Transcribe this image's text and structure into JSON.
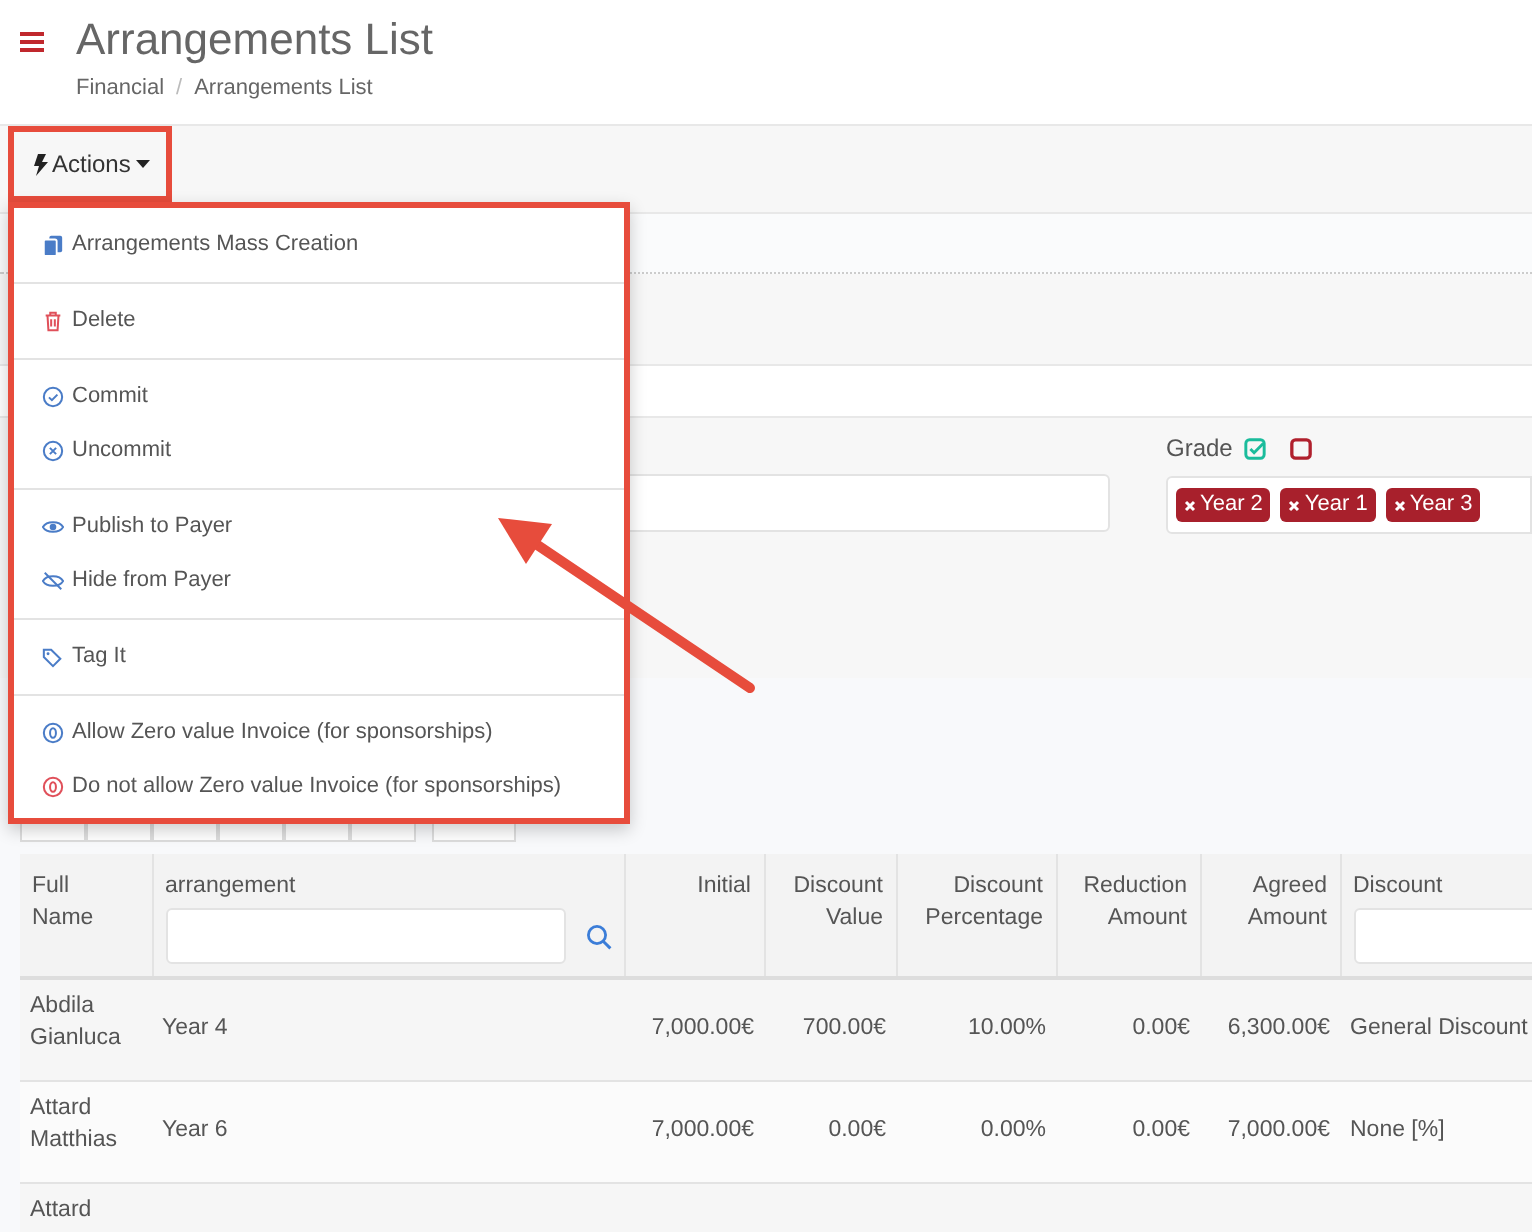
{
  "page": {
    "title": "Arrangements List",
    "breadcrumb_separator": "/",
    "breadcrumb": [
      {
        "label": "Financial"
      },
      {
        "label": "Arrangements List"
      }
    ]
  },
  "actions_button": {
    "label": "Actions"
  },
  "actions_menu": {
    "groups": [
      [
        {
          "label": "Arrangements Mass Creation"
        }
      ],
      [
        {
          "label": "Delete"
        }
      ],
      [
        {
          "label": "Commit"
        },
        {
          "label": "Uncommit"
        }
      ],
      [
        {
          "label": "Publish to Payer"
        },
        {
          "label": "Hide from Payer"
        }
      ],
      [
        {
          "label": "Tag It"
        }
      ],
      [
        {
          "label": "Allow Zero value Invoice (for sponsorships)"
        },
        {
          "label": "Do not allow Zero value Invoice (for sponsorships)"
        }
      ]
    ]
  },
  "grade_filter": {
    "label": "Grade",
    "tags": [
      {
        "label": "Year 2"
      },
      {
        "label": "Year 1"
      },
      {
        "label": "Year 3"
      }
    ]
  },
  "table": {
    "columns": [
      {
        "label": "Full Name",
        "filter": false
      },
      {
        "label": "arrangement",
        "filter": true
      },
      {
        "label": "Initial",
        "filter": false
      },
      {
        "label": "Discount Value",
        "filter": false
      },
      {
        "label": "Discount Percentage",
        "filter": false
      },
      {
        "label": "Reduction Amount",
        "filter": false
      },
      {
        "label": "Agreed Amount",
        "filter": false
      },
      {
        "label": "Discount",
        "filter": true
      }
    ],
    "rows": [
      {
        "cells": [
          "Abdila Gianluca",
          "Year 4",
          "7,000.00€",
          "700.00€",
          "10.00%",
          "0.00€",
          "6,300.00€",
          "General Discount"
        ]
      },
      {
        "cells": [
          "Attard Matthias",
          "Year 6",
          "7,000.00€",
          "0.00€",
          "0.00%",
          "0.00€",
          "7,000.00€",
          "None [%]"
        ]
      },
      {
        "cells": [
          "Attard"
        ]
      }
    ]
  }
}
